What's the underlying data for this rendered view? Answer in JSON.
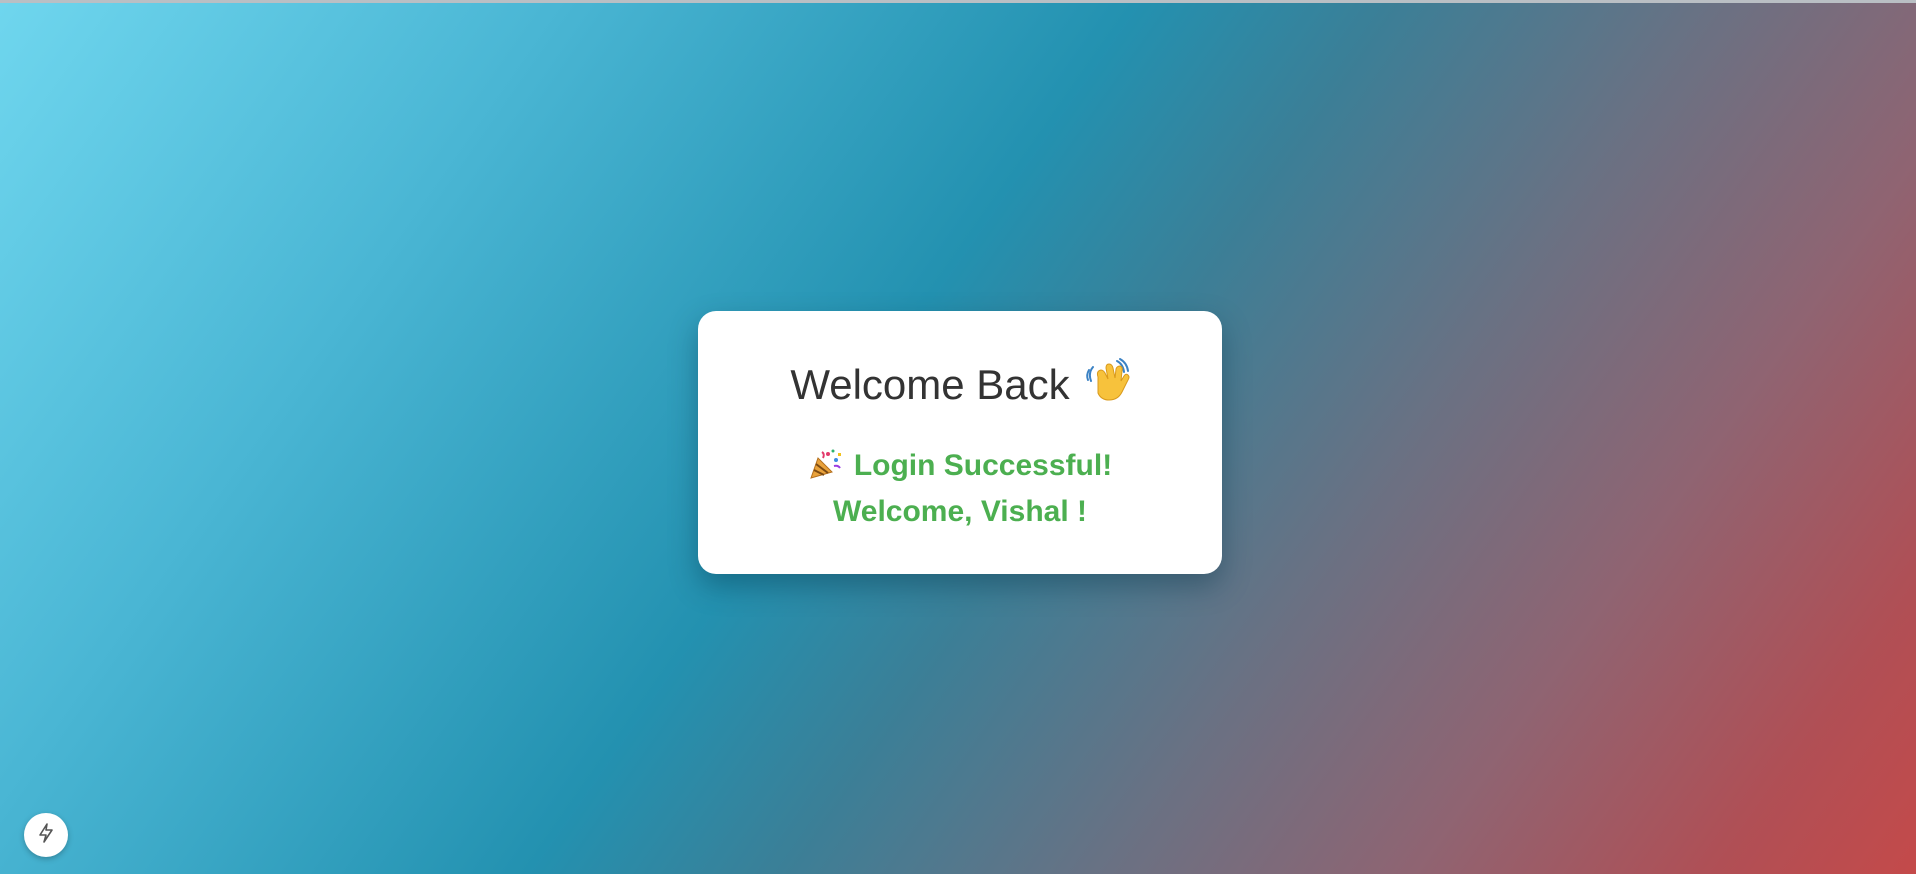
{
  "card": {
    "title": "Welcome Back",
    "title_emoji_icon": "waving-hand-icon",
    "success_icon": "party-popper-icon",
    "success_line": "Login Successful!",
    "welcome_line": "Welcome, Vishal !"
  },
  "fab": {
    "icon": "lightning-bolt-icon"
  },
  "colors": {
    "success_text": "#4caf50",
    "title_text": "#333333",
    "gradient_start": "#6fd6ee",
    "gradient_mid": "#2391b0",
    "gradient_end": "#c44a4a"
  }
}
